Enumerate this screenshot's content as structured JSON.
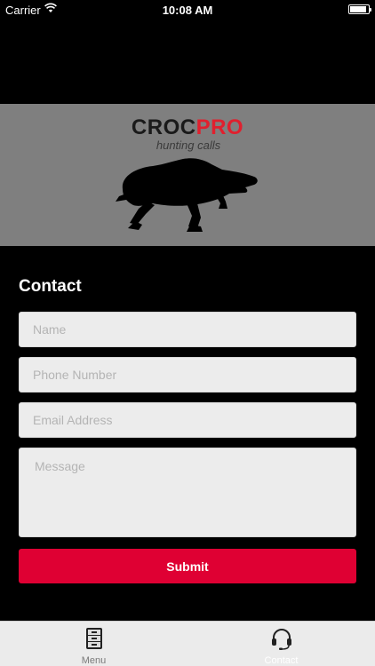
{
  "status_bar": {
    "carrier": "Carrier",
    "time": "10:08 AM",
    "battery_level": 0.9
  },
  "banner": {
    "logo_part1": "CROC",
    "logo_part2": "PRO",
    "tagline": "hunting calls",
    "image": "crocodile-silhouette"
  },
  "contact": {
    "title": "Contact",
    "name_placeholder": "Name",
    "phone_placeholder": "Phone Number",
    "email_placeholder": "Email Address",
    "message_placeholder": "Message",
    "submit_label": "Submit"
  },
  "tabs": [
    {
      "label": "Menu",
      "icon": "file-cabinet-icon"
    },
    {
      "label": "Contact",
      "icon": "headset-icon"
    }
  ],
  "colors": {
    "accent": "#df0033",
    "banner_bg": "#7f7f7f",
    "tabbar_bg": "#ebebeb"
  }
}
